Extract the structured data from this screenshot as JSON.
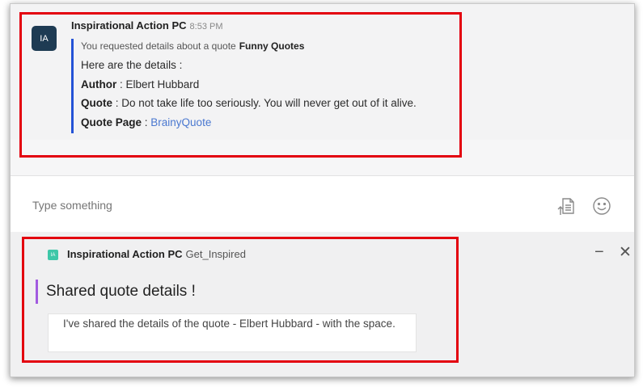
{
  "message": {
    "avatar_initials": "IA",
    "sender": "Inspirational Action PC",
    "time": "8:53 PM",
    "subtitle_prefix": "You requested details about a quote",
    "subtitle_name": "Funny Quotes",
    "intro": "Here are the details :",
    "author_label": "Author",
    "author_value": " : Elbert Hubbard",
    "quote_label": "Quote",
    "quote_value": " : Do not take life too seriously. You will never get out of it alive.",
    "page_label": "Quote Page",
    "page_sep": " : ",
    "page_link": "BrainyQuote"
  },
  "composer": {
    "placeholder": "Type something",
    "attach_icon": "file-upload-icon",
    "emoji_icon": "emoji-icon"
  },
  "card": {
    "bot_initials": "IA",
    "sender": "Inspirational Action PC",
    "command": "Get_Inspired",
    "minimize_glyph": "−",
    "close_glyph": "✕",
    "title": "Shared quote details !",
    "body": "I've shared the details of the quote - Elbert Hubbard - with the space."
  },
  "colors": {
    "highlight_box": "#e3000f",
    "quote_bar": "#2453d6",
    "card_bar": "#a25be0",
    "link": "#4a78d0"
  }
}
